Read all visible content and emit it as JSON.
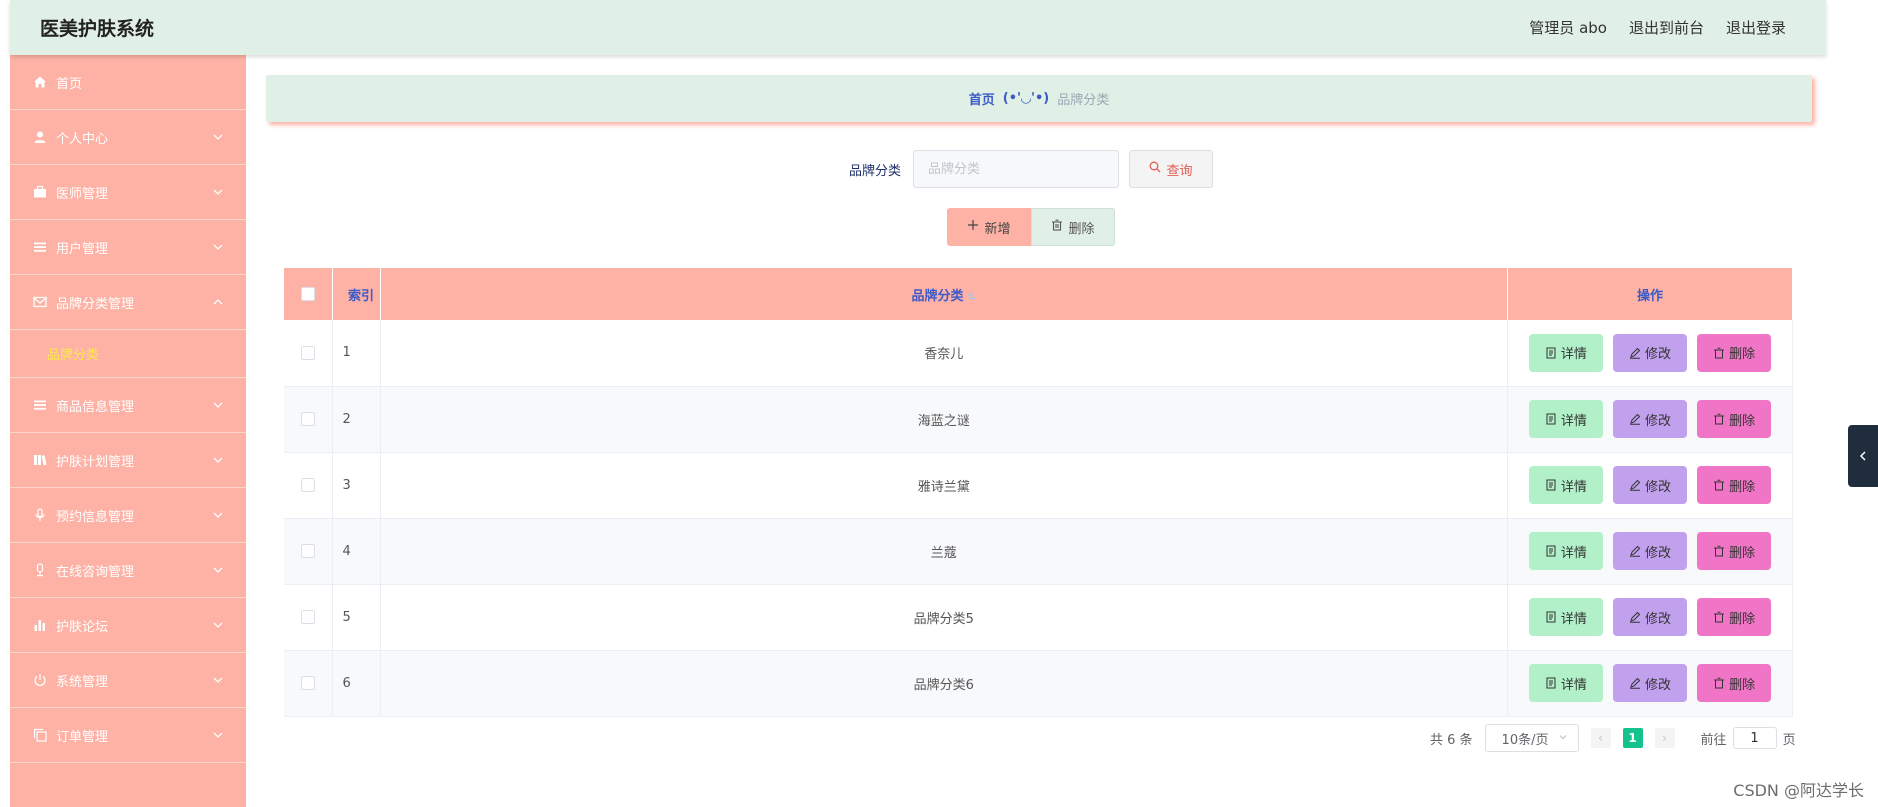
{
  "header": {
    "title": "医美护肤系统",
    "admin_label": "管理员 abo",
    "to_front": "退出到前台",
    "logout": "退出登录"
  },
  "sidebar": {
    "items": [
      {
        "label": "首页",
        "icon": "home-icon",
        "expandable": false
      },
      {
        "label": "个人中心",
        "icon": "user-icon",
        "expandable": true
      },
      {
        "label": "医师管理",
        "icon": "briefcase-icon",
        "expandable": true
      },
      {
        "label": "用户管理",
        "icon": "list-icon",
        "expandable": true
      },
      {
        "label": "品牌分类管理",
        "icon": "mail-icon",
        "expandable": true,
        "expanded": true,
        "children": [
          {
            "label": "品牌分类"
          }
        ]
      },
      {
        "label": "商品信息管理",
        "icon": "list-icon",
        "expandable": true
      },
      {
        "label": "护肤计划管理",
        "icon": "book-icon",
        "expandable": true
      },
      {
        "label": "预约信息管理",
        "icon": "mic-icon",
        "expandable": true
      },
      {
        "label": "在线咨询管理",
        "icon": "microphone-icon",
        "expandable": true
      },
      {
        "label": "护肤论坛",
        "icon": "bar-chart-icon",
        "expandable": true
      },
      {
        "label": "系统管理",
        "icon": "power-icon",
        "expandable": true
      },
      {
        "label": "订单管理",
        "icon": "copy-icon",
        "expandable": true
      }
    ]
  },
  "breadcrumb": {
    "home": "首页",
    "separator": "(•'◡'•)",
    "current": "品牌分类"
  },
  "search": {
    "label": "品牌分类",
    "placeholder": "品牌分类",
    "button": "查询"
  },
  "actions": {
    "add": "新增",
    "delete": "删除"
  },
  "table": {
    "columns": [
      "索引",
      "品牌分类",
      "操作"
    ],
    "rows": [
      {
        "index": "1",
        "brand": "香奈儿"
      },
      {
        "index": "2",
        "brand": "海蓝之谜"
      },
      {
        "index": "3",
        "brand": "雅诗兰黛"
      },
      {
        "index": "4",
        "brand": "兰蔻"
      },
      {
        "index": "5",
        "brand": "品牌分类5"
      },
      {
        "index": "6",
        "brand": "品牌分类6"
      }
    ],
    "ops": {
      "detail": "详情",
      "edit": "修改",
      "delete": "删除"
    }
  },
  "pagination": {
    "total": "共 6 条",
    "page_size": "10条/页",
    "current_page": "1",
    "goto_prefix": "前往",
    "goto_value": "1",
    "goto_suffix": "页"
  },
  "colors": {
    "header_bg": "#e1f0e6",
    "sidebar_bg": "#fdb2a5",
    "submenu_active": "#ffe84f",
    "detail_btn": "#b1f0c8",
    "edit_btn": "#c1a1ed",
    "delete_btn": "#f175c6",
    "page_active": "#13c28c"
  },
  "watermark": "CSDN @阿达学长"
}
